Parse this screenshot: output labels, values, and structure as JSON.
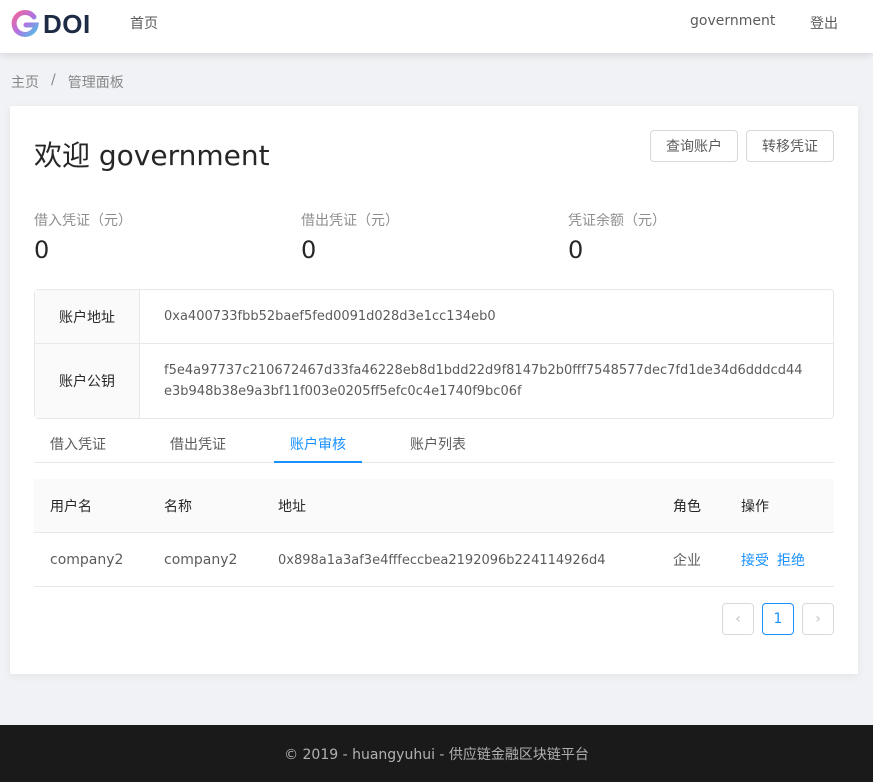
{
  "header": {
    "logo_text": "DOI",
    "nav_home": "首页",
    "username": "government",
    "logout": "登出"
  },
  "breadcrumb": {
    "home": "主页",
    "separator": "/",
    "current": "管理面板"
  },
  "main": {
    "welcome": "欢迎 government",
    "buttons": {
      "query": "查询账户",
      "transfer": "转移凭证"
    },
    "stats": [
      {
        "label": "借入凭证（元）",
        "value": "0"
      },
      {
        "label": "借出凭证（元）",
        "value": "0"
      },
      {
        "label": "凭证余额（元）",
        "value": "0"
      }
    ],
    "account": {
      "address_label": "账户地址",
      "address": "0xa400733fbb52baef5fed0091d028d3e1cc134eb0",
      "pubkey_label": "账户公钥",
      "pubkey": "f5e4a97737c210672467d33fa46228eb8d1bdd22d9f8147b2b0fff7548577dec7fd1de34d6dddcd44e3b948b38e9a3bf11f003e0205ff5efc0c4e1740f9bc06f"
    },
    "tabs": [
      "借入凭证",
      "借出凭证",
      "账户审核",
      "账户列表"
    ],
    "active_tab": "账户审核",
    "table": {
      "headers": [
        "用户名",
        "名称",
        "地址",
        "角色",
        "操作"
      ],
      "rows": [
        {
          "username": "company2",
          "name": "company2",
          "address": "0x898a1a3af3e4fffeccbea2192096b224114926d4",
          "role": "企业",
          "accept": "接受",
          "reject": "拒绝"
        }
      ]
    },
    "pagination": {
      "prev": "‹",
      "current": "1",
      "next": "›"
    }
  },
  "footer": {
    "text": "© 2019 - huangyuhui - 供应链金融区块链平台"
  },
  "colors": {
    "accent": "#1890ff",
    "footer_bg": "#1a1a1a"
  }
}
